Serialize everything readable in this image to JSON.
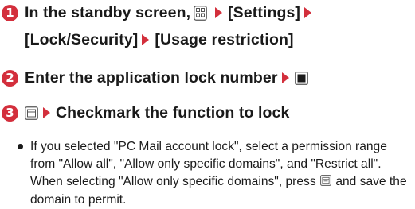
{
  "steps": [
    {
      "number": "1",
      "line1_text": "In the standby screen,",
      "line1_item2": "[Settings]",
      "line2_item1": "[Lock/Security]",
      "line2_item2": "[Usage restriction]",
      "icons": [
        "menu-key-icon",
        "arrow-icon"
      ]
    },
    {
      "number": "2",
      "text": "Enter the application lock number",
      "icons": [
        "arrow-icon",
        "center-key-icon"
      ]
    },
    {
      "number": "3",
      "text": "Checkmark the function to lock",
      "icons": [
        "sub-menu-key-icon",
        "arrow-icon"
      ]
    }
  ],
  "note": {
    "part1": "If you selected \"PC Mail account lock\", select a permission range from \"Allow all\", \"Allow only specific domains\", and \"Restrict all\". When selecting \"Allow only specific domains\", press",
    "part2": "and save the domain to permit."
  },
  "colors": {
    "step_circle": "#d32f3c",
    "arrow": "#d32f3c",
    "text": "#1a1a1a"
  }
}
